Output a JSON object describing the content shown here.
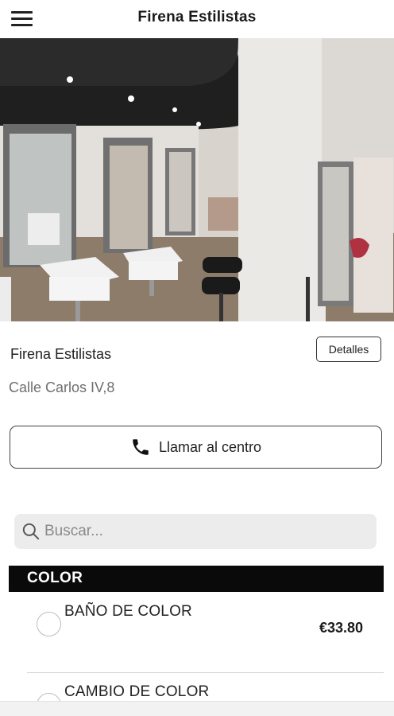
{
  "appbar": {
    "title": "Firena Estilistas",
    "menu_icon": "hamburger-menu-icon"
  },
  "salon": {
    "name": "Firena Estilistas",
    "details_label": "Detalles",
    "address": "Calle Carlos IV,8",
    "call_label": "Llamar al centro",
    "call_icon": "phone-icon"
  },
  "search": {
    "placeholder": "Buscar...",
    "value": "",
    "icon": "search-icon"
  },
  "services": {
    "category": "COLOR",
    "items": [
      {
        "name": "BAÑO DE COLOR",
        "price": "€33.80"
      },
      {
        "name": "CAMBIO DE COLOR",
        "price": ""
      }
    ]
  },
  "colors": {
    "category_bg": "#0a0a0a",
    "search_bg": "#ececec",
    "address_text": "#6f6f6f"
  }
}
